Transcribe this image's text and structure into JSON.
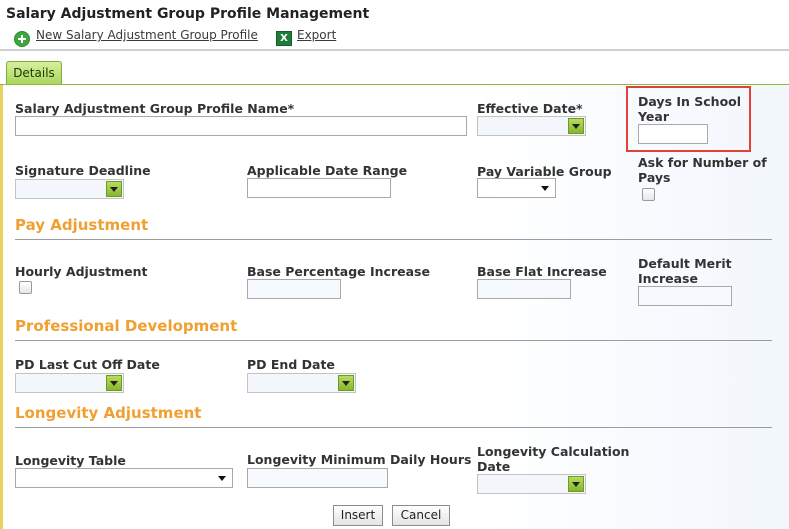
{
  "page": {
    "title": "Salary Adjustment Group Profile Management"
  },
  "toolbar": {
    "new_label": "New Salary Adjustment Group Profile",
    "export_label": "Export",
    "new_icon": "add-circle-icon",
    "export_icon": "excel-icon"
  },
  "tabs": [
    {
      "label": "Details",
      "active": true
    }
  ],
  "form": {
    "profile_name": {
      "label": "Salary Adjustment Group Profile Name*",
      "value": ""
    },
    "effective_date": {
      "label": "Effective Date*",
      "value": ""
    },
    "days_in_school_year": {
      "label": "Days In School Year",
      "value": ""
    },
    "signature_deadline": {
      "label": "Signature Deadline",
      "value": ""
    },
    "applicable_date_range": {
      "label": "Applicable Date Range",
      "value": ""
    },
    "pay_variable_group": {
      "label": "Pay Variable Group",
      "value": ""
    },
    "ask_number_of_pays": {
      "label": "Ask for Number of Pays",
      "checked": false
    },
    "pay_adjustment": {
      "title": "Pay Adjustment",
      "hourly_adjustment": {
        "label": "Hourly Adjustment",
        "checked": false
      },
      "base_percentage_increase": {
        "label": "Base Percentage Increase",
        "value": ""
      },
      "base_flat_increase": {
        "label": "Base Flat Increase",
        "value": ""
      },
      "default_merit_increase": {
        "label": "Default Merit Increase",
        "value": ""
      }
    },
    "professional_development": {
      "title": "Professional Development",
      "pd_last_cut_off_date": {
        "label": "PD Last Cut Off Date",
        "value": ""
      },
      "pd_end_date": {
        "label": "PD End Date",
        "value": ""
      }
    },
    "longevity_adjustment": {
      "title": "Longevity Adjustment",
      "longevity_table": {
        "label": "Longevity Table",
        "value": ""
      },
      "longevity_min_daily_hours": {
        "label": "Longevity Minimum Daily Hours",
        "value": ""
      },
      "longevity_calculation_date": {
        "label": "Longevity Calculation Date",
        "value": ""
      }
    }
  },
  "actions": {
    "insert_label": "Insert",
    "cancel_label": "Cancel"
  },
  "colors": {
    "section_title": "#f0a030",
    "highlight_box": "#e0413a",
    "tab_active": "#a9d45a"
  }
}
